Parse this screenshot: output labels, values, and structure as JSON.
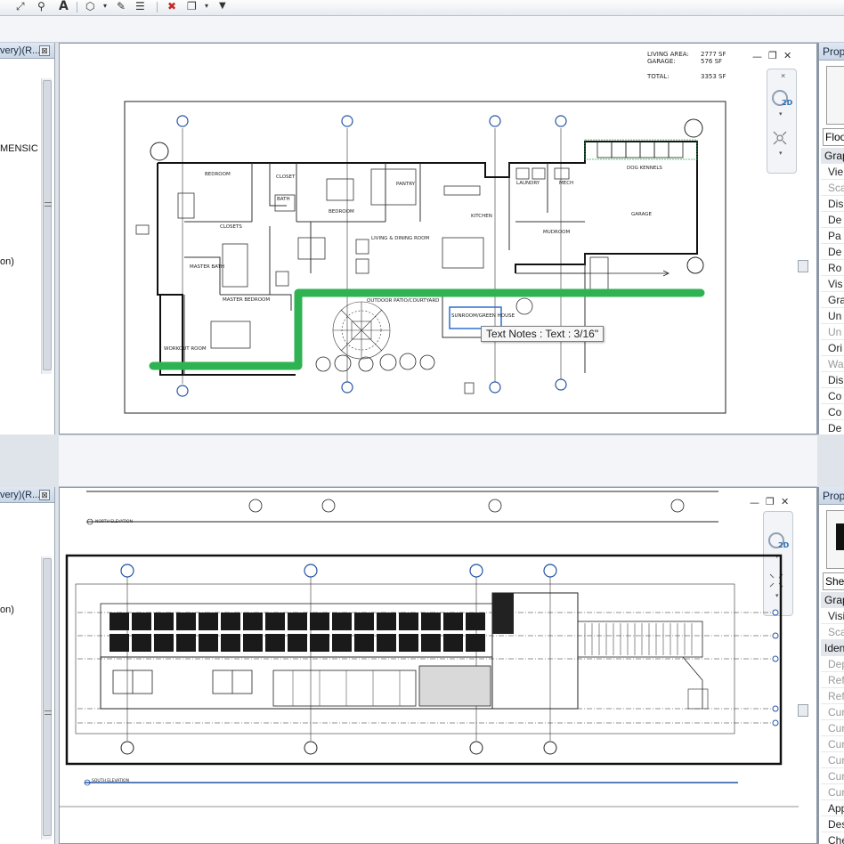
{
  "toolbar": {
    "icons": [
      "dimension-icon",
      "tag-icon",
      "text-icon",
      "component-icon",
      "paint-icon",
      "filter-icon",
      "delete-element-icon",
      "window-switch-icon",
      "dropdown-icon"
    ],
    "text_tool_glyph": "A"
  },
  "project_browser": {
    "title_top": "very)(R...",
    "title_bottom": "very)(R...",
    "close_glyph": "⊠",
    "item_dimension": "MENSIC",
    "item_on_top": "on)",
    "item_on_bottom": "on)"
  },
  "floor_plan_view": {
    "area_schedule": [
      {
        "label": "LIVING AREA:",
        "value": "2777 SF"
      },
      {
        "label": "GARAGE:",
        "value": "576 SF"
      },
      {
        "label": "TOTAL:",
        "value": "3353 SF"
      }
    ],
    "rooms": [
      "BEDROOM",
      "CLOSET",
      "BATH",
      "BEDROOM",
      "PANTRY",
      "KITCHEN",
      "LAUNDRY",
      "MECH",
      "DOG KENNELS",
      "GARAGE",
      "MUDROOM",
      "CLOSETS",
      "MASTER BATH",
      "MASTER BEDROOM",
      "LIVING & DINING ROOM",
      "OUTDOOR PATIO/COURTYARD",
      "SUNROOM/GREEN HOUSE",
      "WORKOUT ROOM"
    ],
    "highlight_color": "#2fb352"
  },
  "tooltip": {
    "text": "Text Notes : Text : 3/16\""
  },
  "elevation_view": {
    "level_label_top": "NORTH ELEVATION",
    "level_label_bottom": "SOUTH ELEVATION"
  },
  "properties_top": {
    "title": "Prop",
    "type_selector": "Floo",
    "rows": [
      {
        "label": "Grap",
        "kind": "hdr"
      },
      {
        "label": "Vie",
        "kind": "row"
      },
      {
        "label": "Sca",
        "kind": "gray"
      },
      {
        "label": "Dis",
        "kind": "row"
      },
      {
        "label": "De",
        "kind": "row"
      },
      {
        "label": "Pa",
        "kind": "row"
      },
      {
        "label": "De",
        "kind": "row"
      },
      {
        "label": "Ro",
        "kind": "row"
      },
      {
        "label": "Vis",
        "kind": "row"
      },
      {
        "label": "Gra",
        "kind": "row"
      },
      {
        "label": "Un",
        "kind": "row"
      },
      {
        "label": "Un",
        "kind": "gray"
      },
      {
        "label": "Ori",
        "kind": "row"
      },
      {
        "label": "Wa",
        "kind": "gray"
      },
      {
        "label": "Dis",
        "kind": "row"
      },
      {
        "label": "Co",
        "kind": "row"
      },
      {
        "label": "Co",
        "kind": "row"
      },
      {
        "label": "De",
        "kind": "row"
      }
    ]
  },
  "properties_bottom": {
    "title": "Prop",
    "type_selector": "Shee",
    "rows": [
      {
        "label": "Grap",
        "kind": "hdr"
      },
      {
        "label": "Visi",
        "kind": "row"
      },
      {
        "label": "Sca",
        "kind": "gray"
      },
      {
        "label": "Iden",
        "kind": "hdr"
      },
      {
        "label": "Dep",
        "kind": "gray"
      },
      {
        "label": "Ref",
        "kind": "gray"
      },
      {
        "label": "Ref",
        "kind": "gray"
      },
      {
        "label": "Cur",
        "kind": "gray"
      },
      {
        "label": "Cur",
        "kind": "gray"
      },
      {
        "label": "Cur",
        "kind": "gray"
      },
      {
        "label": "Cur",
        "kind": "gray"
      },
      {
        "label": "Cur",
        "kind": "gray"
      },
      {
        "label": "Cur",
        "kind": "gray"
      },
      {
        "label": "App",
        "kind": "row"
      },
      {
        "label": "Des",
        "kind": "row"
      },
      {
        "label": "Che",
        "kind": "row"
      }
    ]
  },
  "view_controls": {
    "minimize": "—",
    "restore": "❐",
    "close": "✕",
    "nav_2d": "2D"
  }
}
